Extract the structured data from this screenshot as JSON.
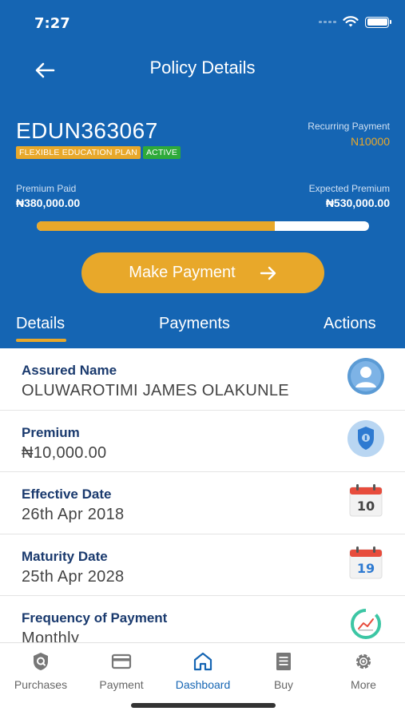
{
  "status": {
    "time": "7:27"
  },
  "header": {
    "title": "Policy Details"
  },
  "policy": {
    "number": "EDUN363067",
    "plan_badge": "FLEXIBLE EDUCATION PLAN",
    "status_badge": "ACTIVE",
    "recurring_label": "Recurring Payment",
    "recurring_value": "N10000",
    "premium_paid_label": "Premium Paid",
    "premium_paid_value": "₦380,000.00",
    "expected_label": "Expected Premium",
    "expected_value": "₦530,000.00",
    "progress_fraction": 0.717
  },
  "make_payment": {
    "label": "Make Payment"
  },
  "tabs": [
    {
      "label": "Details",
      "active": true
    },
    {
      "label": "Payments",
      "active": false
    },
    {
      "label": "Actions",
      "active": false
    }
  ],
  "details": [
    {
      "title": "Assured Name",
      "value": "OLUWAROTIMI JAMES OLAKUNLE",
      "icon": "user-avatar-icon"
    },
    {
      "title": "Premium",
      "value": "₦10,000.00",
      "icon": "shield-coin-icon"
    },
    {
      "title": "Effective Date",
      "value": "26th Apr 2018",
      "icon": "calendar-icon",
      "icon_day": "10"
    },
    {
      "title": "Maturity Date",
      "value": "25th Apr 2028",
      "icon": "calendar-icon",
      "icon_day": "19"
    },
    {
      "title": "Frequency of Payment",
      "value": "Monthly",
      "icon": "cycle-chart-icon"
    }
  ],
  "tabbar": [
    {
      "label": "Purchases",
      "icon": "shield-icon",
      "active": false
    },
    {
      "label": "Payment",
      "icon": "card-icon",
      "active": false
    },
    {
      "label": "Dashboard",
      "icon": "home-icon",
      "active": true
    },
    {
      "label": "Buy",
      "icon": "receipt-icon",
      "active": false
    },
    {
      "label": "More",
      "icon": "gear-icon",
      "active": false
    }
  ],
  "colors": {
    "primary": "#1565b3",
    "accent": "#e8a82a",
    "active_green": "#2eaa3a"
  }
}
